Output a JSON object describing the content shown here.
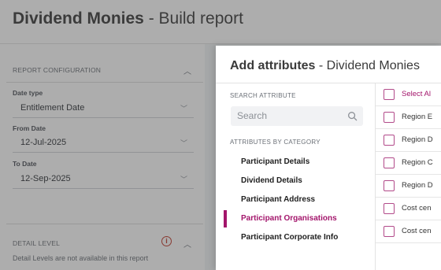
{
  "page": {
    "title_bold": "Dividend Monies",
    "title_rest": " - Build report"
  },
  "sidebar": {
    "config_heading": "REPORT CONFIGURATION",
    "date_type_label": "Date type",
    "date_type_value": "Entitlement Date",
    "from_date_label": "From Date",
    "from_date_value": "12-Jul-2025",
    "to_date_label": "To Date",
    "to_date_value": "12-Sep-2025",
    "detail_heading": "DETAIL LEVEL",
    "detail_note": "Detail Levels are not available in this report"
  },
  "modal": {
    "title_bold": "Add attributes",
    "title_rest": " - Dividend Monies",
    "search_label": "SEARCH ATTRIBUTE",
    "search_placeholder": "Search",
    "categories_label": "ATTRIBUTES BY CATEGORY",
    "categories": [
      {
        "label": "Participant Details"
      },
      {
        "label": "Dividend Details"
      },
      {
        "label": "Participant Address"
      },
      {
        "label": "Participant Organisations",
        "active": true
      },
      {
        "label": "Participant Corporate Info"
      }
    ],
    "select_all_label": "Select Al",
    "attributes": [
      {
        "label": "Region E"
      },
      {
        "label": "Region D"
      },
      {
        "label": "Region C"
      },
      {
        "label": "Region D"
      },
      {
        "label": "Cost cen"
      },
      {
        "label": "Cost cen"
      }
    ]
  },
  "colors": {
    "accent": "#a3156b",
    "warning": "#c0392b"
  },
  "icons": {
    "search": "search-icon",
    "chevron_down": "chevron-down-icon",
    "chevron_up": "chevron-up-icon",
    "info": "info-icon"
  }
}
